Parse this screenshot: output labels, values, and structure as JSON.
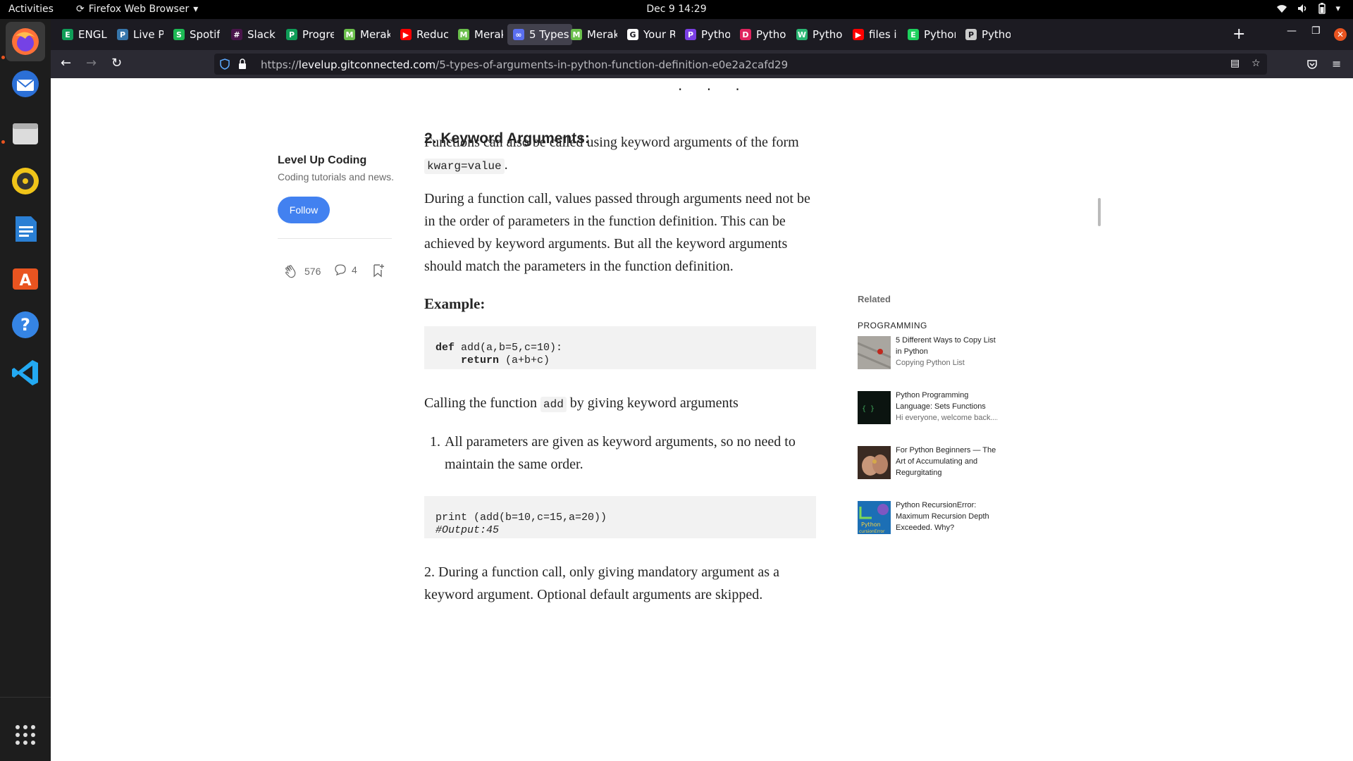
{
  "system": {
    "activities": "Activities",
    "app_name": "Firefox Web Browser",
    "clock": "Dec 9  14:29"
  },
  "dock": {
    "apps": [
      "firefox-icon",
      "thunderbird-icon",
      "files-icon",
      "rhythmbox-icon",
      "writer-icon",
      "software-icon",
      "help-icon",
      "vscode-icon",
      "app-grid-icon"
    ]
  },
  "tabs": [
    {
      "label": "ENGLISH",
      "fav": "E",
      "color": "#0f9d58"
    },
    {
      "label": "Live Pro",
      "fav": "P",
      "color": "#3776ab"
    },
    {
      "label": "Spotify",
      "fav": "S",
      "color": "#1db954"
    },
    {
      "label": "Slack | I",
      "fav": "#",
      "color": "#4a154b"
    },
    {
      "label": "Progress",
      "fav": "P",
      "color": "#0f9d58"
    },
    {
      "label": "Meraki",
      "fav": "M",
      "color": "#6abf4b"
    },
    {
      "label": "Reduce",
      "fav": "▶",
      "color": "#ff0000"
    },
    {
      "label": "Meraki",
      "fav": "M",
      "color": "#6abf4b"
    },
    {
      "label": "5 Types",
      "fav": "∞",
      "color": "#5a6ff0",
      "active": true
    },
    {
      "label": "Meraki",
      "fav": "M",
      "color": "#6abf4b"
    },
    {
      "label": "Your Re",
      "fav": "G",
      "color": "#ffffff"
    },
    {
      "label": "Python I",
      "fav": "P",
      "color": "#7b3fe4"
    },
    {
      "label": "Python I",
      "fav": "D",
      "color": "#e0245e"
    },
    {
      "label": "Python I",
      "fav": "W",
      "color": "#2bb673"
    },
    {
      "label": "files in p",
      "fav": "▶",
      "color": "#ff0000"
    },
    {
      "label": "Python I",
      "fav": "E",
      "color": "#1dd15d"
    },
    {
      "label": "Python",
      "fav": "P",
      "color": "#cccccc"
    }
  ],
  "nav": {
    "url_scheme": "https://",
    "url_host": "levelup.gitconnected.com",
    "url_path": "/5-types-of-arguments-in-python-function-definition-e0e2a2cafd29"
  },
  "sidebar": {
    "publication": "Level Up Coding",
    "tagline": "Coding tutorials and news.",
    "follow_label": "Follow",
    "claps": "576",
    "responses": "4"
  },
  "article": {
    "dots": "· · ·",
    "heading": "2. Keyword Arguments:",
    "p1_text": "Functions can also be called using keyword arguments of the form",
    "p1_code": "kwarg=value",
    "p1_end": ".",
    "p2": "During a function call, values passed through arguments need not be in the order of parameters in the function definition. This can be achieved by keyword arguments. But all the keyword arguments should match the parameters in the function definition.",
    "example_label": "Example:",
    "code1_kw1": "def",
    "code1_line1": " add(a,b=5,c=10):",
    "code1_indent": "    ",
    "code1_kw2": "return",
    "code1_line2": " (a+b+c)",
    "p3_a": "Calling the function ",
    "p3_code": "add",
    "p3_b": " by giving keyword arguments",
    "li1_num": "1.",
    "li1": "All parameters are given as keyword arguments, so no need to maintain the same order.",
    "code2_line1": "print (add(b=10,c=15,a=20))",
    "code2_line2": "#Output:45",
    "p4": "2. During a function call, only giving mandatory argument as a keyword argument. Optional default arguments are skipped."
  },
  "related": {
    "label": "Related",
    "category": "PROGRAMMING",
    "items": [
      {
        "title": "5 Different Ways to Copy List in Python",
        "subtitle": "Copying Python List"
      },
      {
        "title": "Python Programming Language: Sets Functions",
        "subtitle": "Hi everyone, welcome back...."
      },
      {
        "title": "For Python Beginners — The Art of Accumulating and Regurgitating",
        "subtitle": ""
      },
      {
        "title": "Python RecursionError: Maximum Recursion Depth Exceeded. Why?",
        "subtitle": ""
      }
    ]
  }
}
